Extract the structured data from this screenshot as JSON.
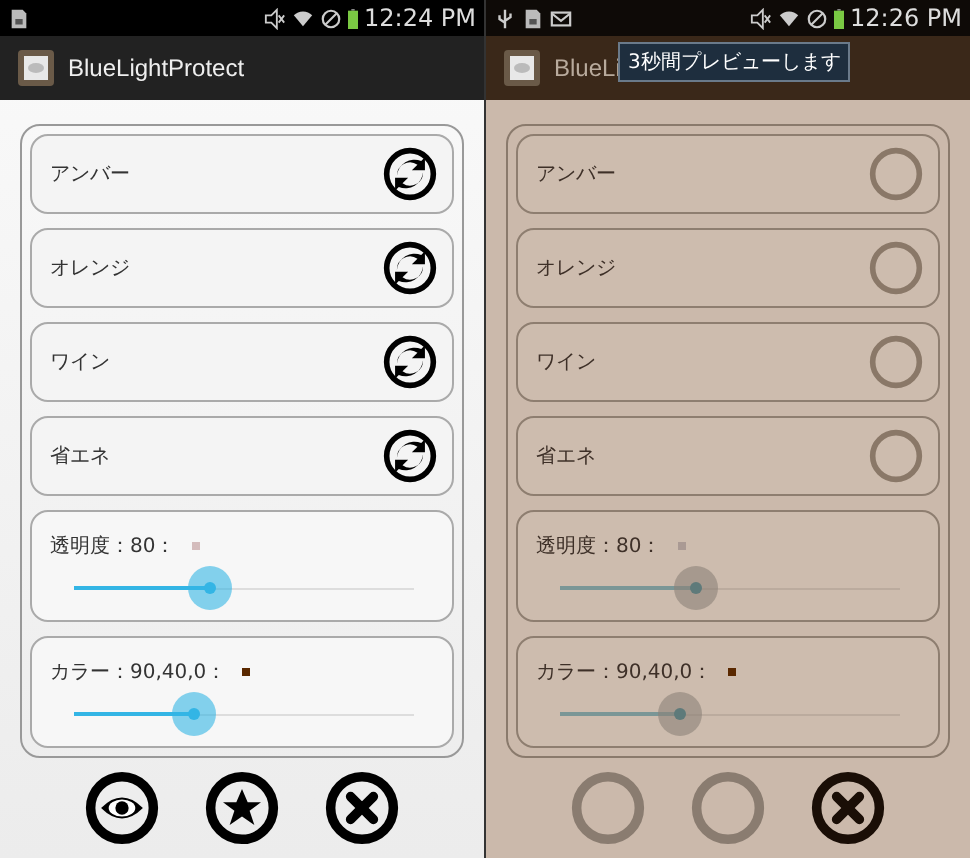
{
  "screens": [
    {
      "tinted": false,
      "notification_icons": [
        {
          "kind": "sim"
        }
      ],
      "time": "12:24 PM",
      "title": "BlueLightProtect",
      "presets": [
        {
          "label": "アンバー"
        },
        {
          "label": "オレンジ"
        },
        {
          "label": "ワイン"
        },
        {
          "label": "省エネ"
        }
      ],
      "sliders": [
        {
          "label": "透明度：80：",
          "color": "#d4bcbc",
          "level": 0.4
        },
        {
          "label": "カラー：90,40,0：",
          "color": "#5a2800",
          "level": 0.35
        }
      ],
      "buttons": [
        {
          "kind": "eye"
        },
        {
          "kind": "star"
        },
        {
          "kind": "close"
        }
      ]
    },
    {
      "tinted": true,
      "notification_icons": [
        {
          "kind": "usb"
        },
        {
          "kind": "sim"
        },
        {
          "kind": "mail"
        }
      ],
      "time": "12:26 PM",
      "title": "BlueLi",
      "toast": "3秒間プレビューします",
      "presets": [
        {
          "label": "アンバー"
        },
        {
          "label": "オレンジ"
        },
        {
          "label": "ワイン"
        },
        {
          "label": "省エネ"
        }
      ],
      "sliders": [
        {
          "label": "透明度：80：",
          "color": "#aa9a94",
          "level": 0.4
        },
        {
          "label": "カラー：90,40,0：",
          "color": "#5a2800",
          "level": 0.35
        }
      ],
      "buttons": [
        {
          "kind": "ring"
        },
        {
          "kind": "ring"
        },
        {
          "kind": "close"
        }
      ]
    }
  ]
}
